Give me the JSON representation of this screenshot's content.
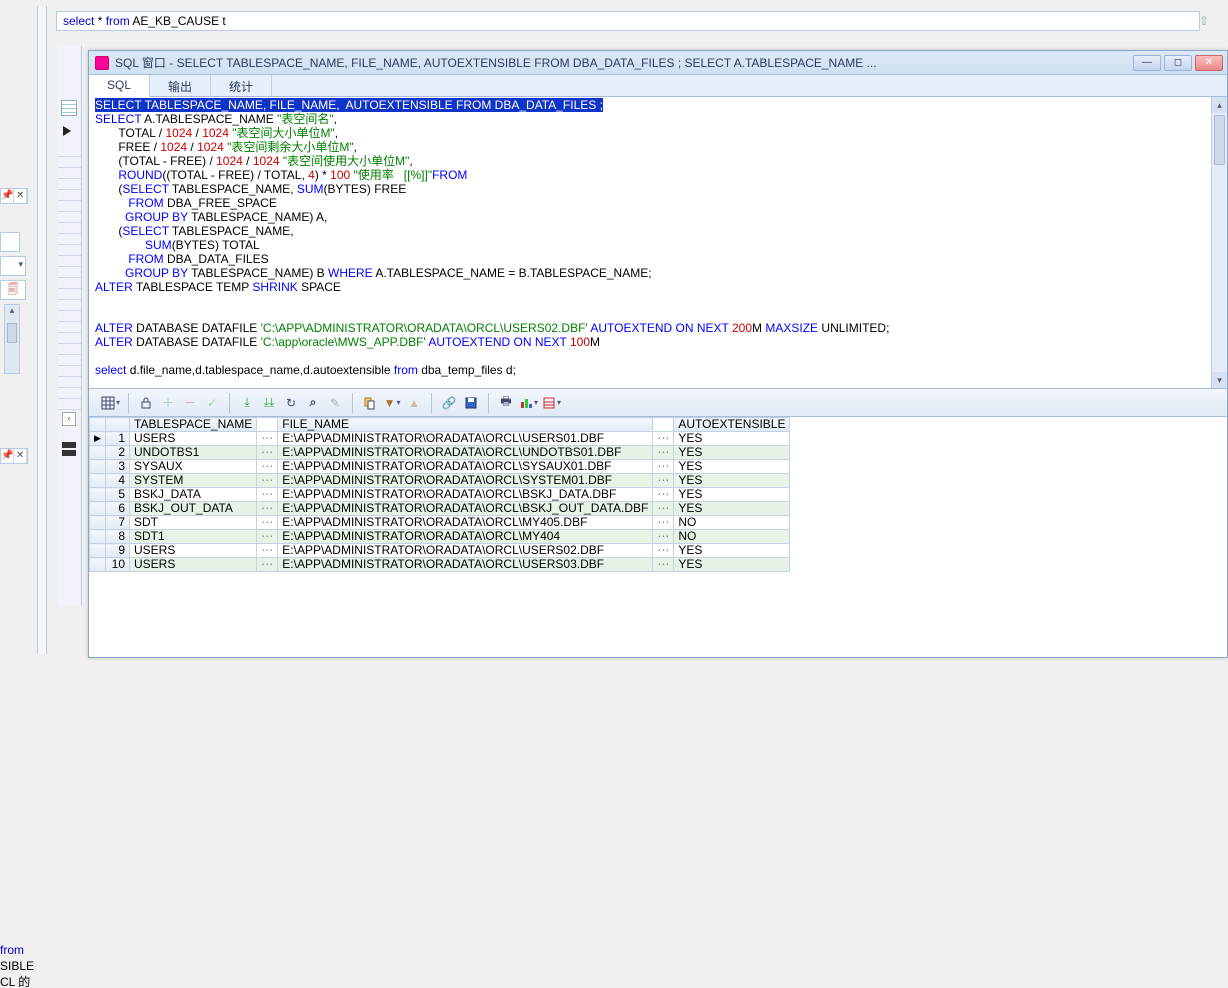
{
  "top_sql": {
    "kw1": "select",
    "rest": " * ",
    "kw2": "from",
    "tbl": " AE_KB_CAUSE t"
  },
  "top_tabs": {
    "t1": "输出",
    "t2": "统计"
  },
  "fragments": {
    "l1": "from",
    "l2": "SIBLE",
    "l3": "CL 的"
  },
  "window": {
    "title": "SQL 窗口 - SELECT TABLESPACE_NAME, FILE_NAME, AUTOEXTENSIBLE FROM DBA_DATA_FILES ; SELECT A.TABLESPACE_NAME ..."
  },
  "tabs": {
    "sql": "SQL",
    "out": "输出",
    "stat": "统计"
  },
  "code": {
    "l1": "SELECT TABLESPACE_NAME, FILE_NAME,  AUTOEXTENSIBLE FROM DBA_DATA_FILES ;",
    "l2a": "SELECT",
    "l2b": " A.TABLESPACE_NAME ",
    "l2c": "\"表空间名\"",
    "l2d": ",",
    "l3a": "       TOTAL / ",
    "l3n1": "1024",
    "l3b": " / ",
    "l3n2": "1024",
    "l3c": " ",
    "l3s": "\"表空间大小单位M\"",
    "l3d": ",",
    "l4a": "       FREE / ",
    "l4n1": "1024",
    "l4b": " / ",
    "l4n2": "1024",
    "l4c": " ",
    "l4s": "\"表空间剩余大小单位M\"",
    "l4d": ",",
    "l5a": "       (TOTAL - FREE) / ",
    "l5n1": "1024",
    "l5b": " / ",
    "l5n2": "1024",
    "l5c": " ",
    "l5s": "\"表空间使用大小单位M\"",
    "l5d": ",",
    "l6a": "       ",
    "l6k": "ROUND",
    "l6b": "((TOTAL - FREE) / TOTAL, ",
    "l6n": "4",
    "l6c": ") * ",
    "l6n2": "100",
    "l6d": " ",
    "l6s": "\"使用率   [[%]]\"",
    "l6k2": "FROM",
    "l7a": "       (",
    "l7k": "SELECT",
    "l7b": " TABLESPACE_NAME, ",
    "l7k2": "SUM",
    "l7c": "(BYTES) FREE",
    "l8a": "          ",
    "l8k": "FROM",
    "l8b": " DBA_FREE_SPACE",
    "l9a": "         ",
    "l9k": "GROUP",
    "l9b": " ",
    "l9k2": "BY",
    "l9c": " TABLESPACE_NAME) A,",
    "l10a": "       (",
    "l10k": "SELECT",
    "l10b": " TABLESPACE_NAME,",
    "l11a": "               ",
    "l11k": "SUM",
    "l11b": "(BYTES) TOTAL",
    "l12a": "          ",
    "l12k": "FROM",
    "l12b": " DBA_DATA_FILES",
    "l13a": "         ",
    "l13k": "GROUP",
    "l13b": " ",
    "l13k2": "BY",
    "l13c": " TABLESPACE_NAME) B ",
    "l13k3": "WHERE",
    "l13d": " A.TABLESPACE_NAME = B.TABLESPACE_NAME;",
    "l14a": "ALTER",
    "l14b": " TABLESPACE TEMP ",
    "l14k": "SHRINK",
    "l14c": " SPACE",
    "l15": "",
    "l16a": "ALTER",
    "l16b": " DATABASE DATAFILE ",
    "l16s": "'C:\\APP\\ADMINISTRATOR\\ORADATA\\ORCL\\USERS02.DBF'",
    "l16c": " ",
    "l16k": "AUTOEXTEND",
    "l16d": " ",
    "l16k2": "ON",
    "l16e": " ",
    "l16k3": "NEXT",
    "l16f": " ",
    "l16n": "200",
    "l16g": "M ",
    "l16k4": "MAXSIZE",
    "l16h": " UNLIMITED;",
    "l17a": "ALTER",
    "l17b": " DATABASE DATAFILE ",
    "l17s": "'C:\\app\\oracle\\MWS_APP.DBF'",
    "l17c": " ",
    "l17k": "AUTOEXTEND",
    "l17d": " ",
    "l17k2": "ON",
    "l17e": " ",
    "l17k3": "NEXT",
    "l17f": " ",
    "l17n": "100",
    "l17g": "M",
    "l18": "",
    "l19a": "select",
    "l19b": " d.file_name,d.tablespace_name,d.autoextensible ",
    "l19k": "from",
    "l19c": " dba_temp_files d;"
  },
  "results": {
    "headers": {
      "ts": "TABLESPACE_NAME",
      "fn": "FILE_NAME",
      "ae": "AUTOEXTENSIBLE"
    },
    "rows": [
      {
        "n": "1",
        "ts": "USERS",
        "fn": "E:\\APP\\ADMINISTRATOR\\ORADATA\\ORCL\\USERS01.DBF",
        "ae": "YES"
      },
      {
        "n": "2",
        "ts": "UNDOTBS1",
        "fn": "E:\\APP\\ADMINISTRATOR\\ORADATA\\ORCL\\UNDOTBS01.DBF",
        "ae": "YES"
      },
      {
        "n": "3",
        "ts": "SYSAUX",
        "fn": "E:\\APP\\ADMINISTRATOR\\ORADATA\\ORCL\\SYSAUX01.DBF",
        "ae": "YES"
      },
      {
        "n": "4",
        "ts": "SYSTEM",
        "fn": "E:\\APP\\ADMINISTRATOR\\ORADATA\\ORCL\\SYSTEM01.DBF",
        "ae": "YES"
      },
      {
        "n": "5",
        "ts": "BSKJ_DATA",
        "fn": "E:\\APP\\ADMINISTRATOR\\ORADATA\\ORCL\\BSKJ_DATA.DBF",
        "ae": "YES"
      },
      {
        "n": "6",
        "ts": "BSKJ_OUT_DATA",
        "fn": "E:\\APP\\ADMINISTRATOR\\ORADATA\\ORCL\\BSKJ_OUT_DATA.DBF",
        "ae": "YES"
      },
      {
        "n": "7",
        "ts": "SDT",
        "fn": "E:\\APP\\ADMINISTRATOR\\ORADATA\\ORCL\\MY405.DBF",
        "ae": "NO"
      },
      {
        "n": "8",
        "ts": "SDT1",
        "fn": "E:\\APP\\ADMINISTRATOR\\ORADATA\\ORCL\\MY404",
        "ae": "NO"
      },
      {
        "n": "9",
        "ts": "USERS",
        "fn": "E:\\APP\\ADMINISTRATOR\\ORADATA\\ORCL\\USERS02.DBF",
        "ae": "YES"
      },
      {
        "n": "10",
        "ts": "USERS",
        "fn": "E:\\APP\\ADMINISTRATOR\\ORADATA\\ORCL\\USERS03.DBF",
        "ae": "YES"
      }
    ]
  },
  "glyphs": {
    "dots": "⋯",
    "play": "▶"
  }
}
